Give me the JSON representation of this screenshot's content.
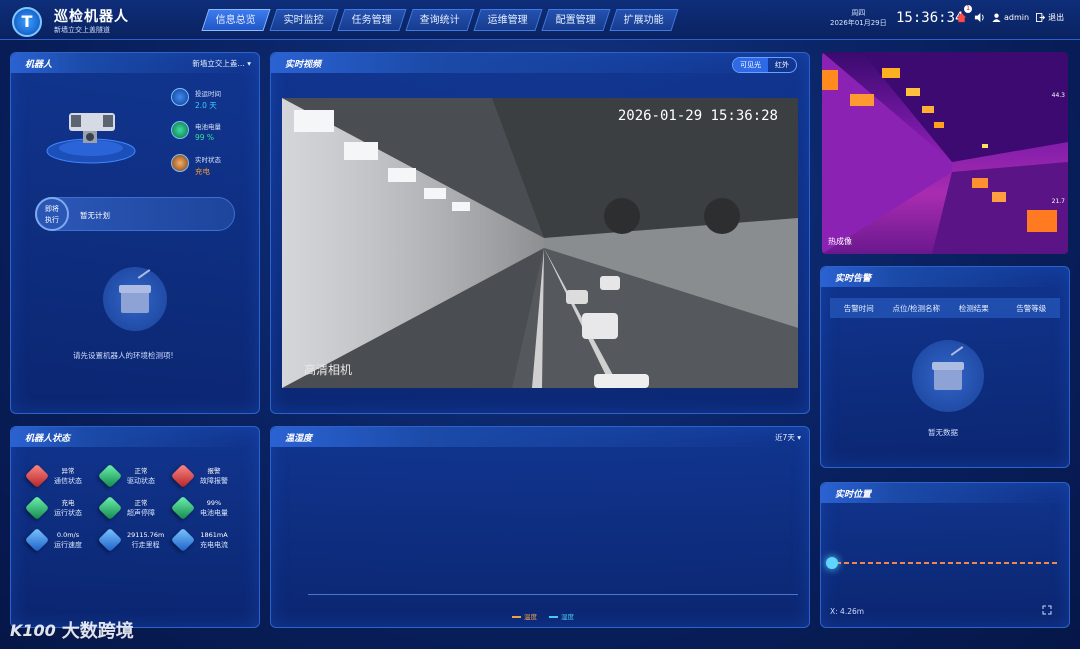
{
  "header": {
    "app_title": "巡检机器人",
    "subtitle": "新墙立交上盖隧道",
    "nav": [
      "信息总览",
      "实时监控",
      "任务管理",
      "查询统计",
      "运维管理",
      "配置管理",
      "扩展功能"
    ],
    "weekday": "周四",
    "date": "2026年01月29日",
    "time": "15:36:34",
    "user": "admin",
    "logout": "退出",
    "alarm_badge": "1"
  },
  "robot_panel": {
    "title": "机器人",
    "selector": "新墙立交上盖…",
    "stats": [
      {
        "label": "投运时间",
        "value": "2.0 天"
      },
      {
        "label": "电池电量",
        "value": "99 %"
      },
      {
        "label": "实时状态",
        "value": "充电"
      }
    ],
    "plan_badge_line1": "即将",
    "plan_badge_line2": "执行",
    "plan_text": "暂无计划",
    "env_hint": "请先设置机器人的环境检测项!"
  },
  "robot_status": {
    "title": "机器人状态",
    "items": [
      {
        "value": "异常",
        "label": "通信状态",
        "color": "red"
      },
      {
        "value": "正常",
        "label": "驱动状态",
        "color": "green"
      },
      {
        "value": "报警",
        "label": "故障报警",
        "color": "red"
      },
      {
        "value": "充电",
        "label": "运行状态",
        "color": "green"
      },
      {
        "value": "正常",
        "label": "超声停障",
        "color": "green"
      },
      {
        "value": "99%",
        "label": "电池电量",
        "color": "green"
      },
      {
        "value": "0.0m/s",
        "label": "运行速度",
        "color": "blue"
      },
      {
        "value": "29115.76m",
        "label": "行走里程",
        "color": "blue"
      },
      {
        "value": "1861mA",
        "label": "充电电流",
        "color": "blue"
      }
    ]
  },
  "video_panel": {
    "title": "实时视频",
    "toggle_visible": "可见光",
    "toggle_ir": "红外",
    "timestamp": "2026-01-29 15:36:28",
    "camera_label": "高清相机"
  },
  "thermal": {
    "label": "热成像",
    "scale_max": "44.3",
    "scale_min": "21.7"
  },
  "alarm_panel": {
    "title": "实时告警",
    "columns": [
      "告警时间",
      "点位/检测名称",
      "检测结果",
      "告警等级"
    ],
    "empty": "暂无数据"
  },
  "temp_panel": {
    "title": "温湿度",
    "range": "近7天",
    "legend": [
      {
        "name": "温度",
        "color": "#f0a04a"
      },
      {
        "name": "湿度",
        "color": "#4ac8f0"
      }
    ]
  },
  "position_panel": {
    "title": "实时位置",
    "x_readout": "X: 4.26m"
  },
  "watermark": {
    "logo": "K100",
    "text": "大数跨境"
  },
  "colors": {
    "accent": "#2e6ae8",
    "ok": "#35e39a",
    "warn": "#f39a3b",
    "alarm": "#e04848"
  }
}
